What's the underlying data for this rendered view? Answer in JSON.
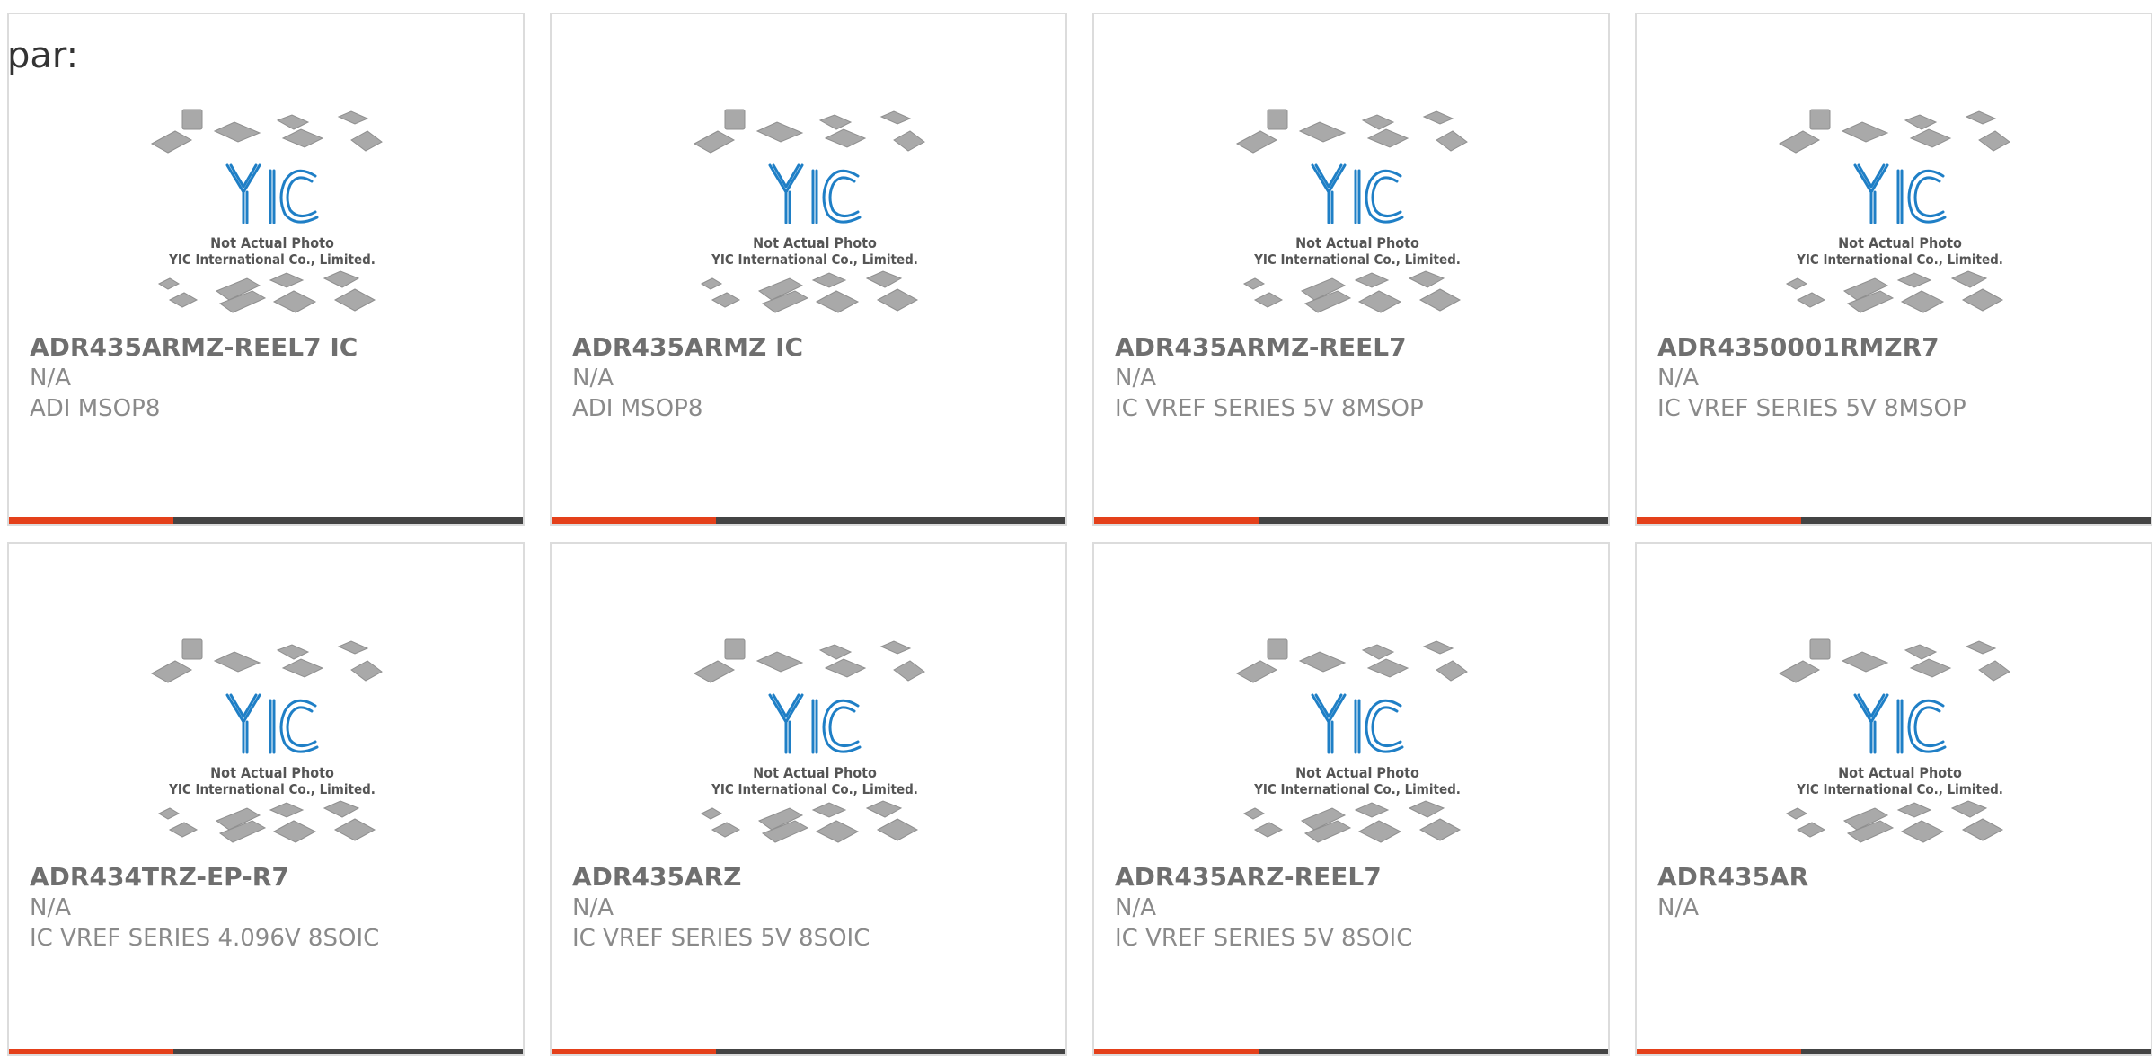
{
  "page": {
    "prefix_text": "par:",
    "photo_caption_line1": "Not Actual Photo",
    "photo_caption_line2": "YIC International Co., Limited.",
    "logo_text": "YIC"
  },
  "colors": {
    "accent": "#e4401a",
    "bar_dark": "#444444",
    "logo_blue": "#1f7fc6",
    "chip_gray": "#a9a9a9"
  },
  "products": [
    {
      "name": "ADR435ARMZ-REEL7 IC",
      "price": "N/A",
      "desc": "ADI MSOP8"
    },
    {
      "name": "ADR435ARMZ IC",
      "price": "N/A",
      "desc": "ADI MSOP8"
    },
    {
      "name": "ADR435ARMZ-REEL7",
      "price": "N/A",
      "desc": "IC VREF SERIES 5V 8MSOP"
    },
    {
      "name": "ADR4350001RMZR7",
      "price": "N/A",
      "desc": "IC VREF SERIES 5V 8MSOP"
    },
    {
      "name": "ADR434TRZ-EP-R7",
      "price": "N/A",
      "desc": "IC VREF SERIES 4.096V 8SOIC"
    },
    {
      "name": "ADR435ARZ",
      "price": "N/A",
      "desc": "IC VREF SERIES 5V 8SOIC"
    },
    {
      "name": "ADR435ARZ-REEL7",
      "price": "N/A",
      "desc": "IC VREF SERIES 5V 8SOIC"
    },
    {
      "name": "ADR435AR",
      "price": "N/A",
      "desc": ""
    }
  ]
}
